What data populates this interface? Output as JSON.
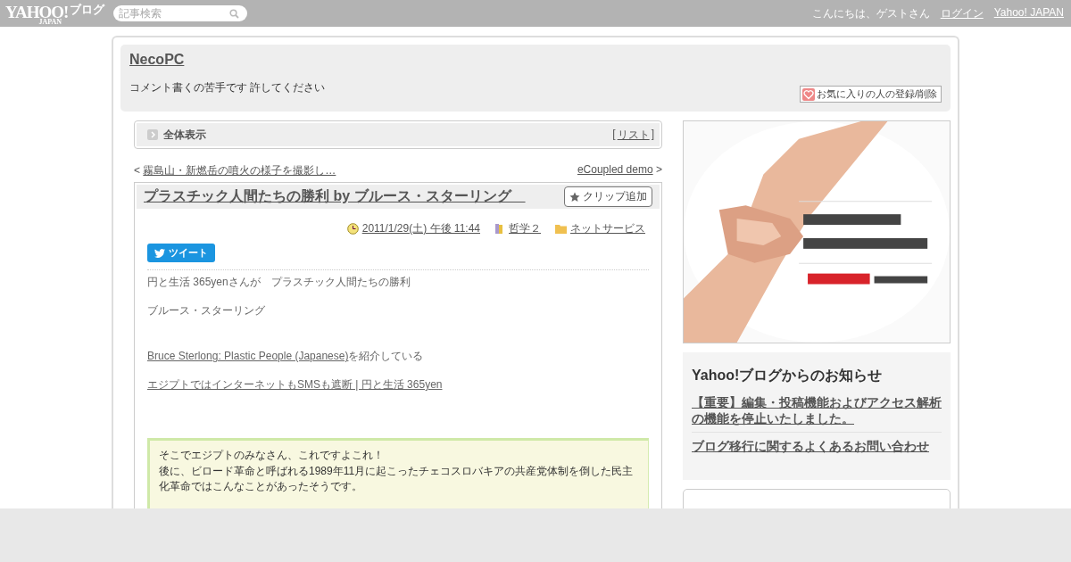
{
  "topbar": {
    "logo": {
      "main": "YAHOO!",
      "sub": "JAPAN",
      "service": "ブログ"
    },
    "search": {
      "placeholder": "記事検索"
    },
    "greeting": "こんにちは、ゲストさん",
    "links": [
      "ログイン",
      "Yahoo! JAPAN"
    ]
  },
  "blog": {
    "title": "NecoPC",
    "description": "コメント書くの苦手です 許してください",
    "favorite_button": "お気に入りの人の登録/削除"
  },
  "view_bar": {
    "label": "全体表示",
    "open_bracket": "[",
    "list_link": "リスト",
    "close_bracket": "]"
  },
  "nav": {
    "prev_mark": "<",
    "prev": "霧島山・新燃岳の噴火の様子を撮影し…",
    "next": "eCoupled demo",
    "next_mark": ">"
  },
  "article": {
    "title": "プラスチック人間たちの勝利 by ブルース・スターリング　",
    "clip_button": "クリップ追加",
    "date": "2011/1/29(土) 午後 11:44",
    "category": "哲学２",
    "folder": "ネットサービス",
    "tweet_button": "ツイート",
    "body": [
      {
        "kind": "text",
        "text": "円と生活 365yenさんが　プラスチック人間たちの勝利"
      },
      {
        "kind": "text",
        "text": "ブルース・スターリング"
      },
      {
        "kind": "gap"
      },
      {
        "kind": "link_text",
        "link": "Bruce Sterlong: Plastic People (Japanese)",
        "text": "を紹介している"
      },
      {
        "kind": "link",
        "link": "エジプトではインターネットもSMSも遮断 | 円と生活 365yen"
      },
      {
        "kind": "gap"
      }
    ],
    "quote": [
      "そこでエジプトのみなさん、これですよこれ！",
      "後に、ビロード革命と呼ばれる1989年11月に起こったチェコスロバキアの共産党体制を倒した民主化革命ではこんなことがあったそうです。"
    ]
  },
  "sidebar": {
    "notice": {
      "title": "Yahoo!ブログからのお知らせ",
      "links": [
        "【重要】編集・投稿機能およびアクセス解析の機能を停止いたしました。",
        "ブログ移行に関するよくあるお問い合わせ"
      ]
    }
  }
}
